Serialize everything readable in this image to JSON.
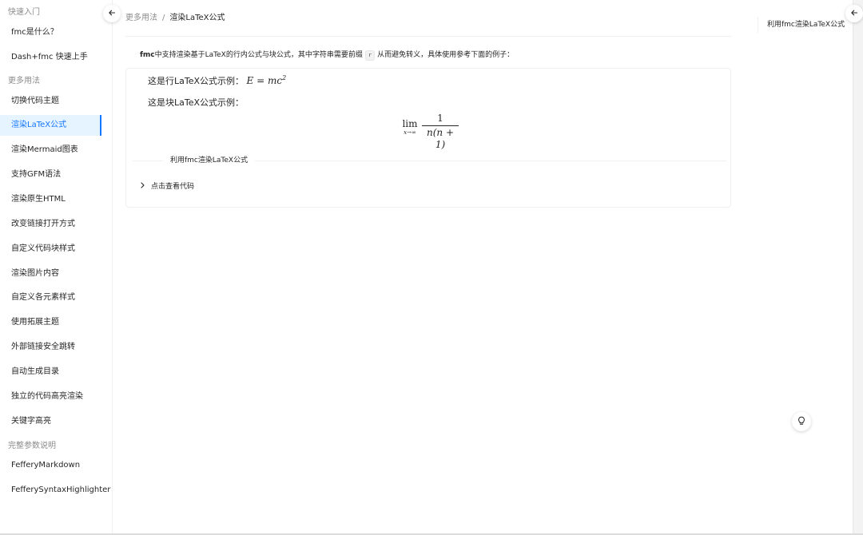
{
  "sidebar": {
    "groups": [
      {
        "title": "快速入门",
        "items": [
          "fmc是什么？",
          "Dash+fmc 快速上手"
        ]
      },
      {
        "title": "更多用法",
        "items": [
          "切换代码主题",
          "渲染LaTeX公式",
          "渲染Mermaid图表",
          "支持GFM语法",
          "渲染原生HTML",
          "改变链接打开方式",
          "自定义代码块样式",
          "渲染图片内容",
          "自定义各元素样式",
          "使用拓展主题",
          "外部链接安全跳转",
          "自动生成目录",
          "独立的代码高亮渲染",
          "关键字高亮"
        ]
      },
      {
        "title": "完整参数说明",
        "items": [
          "FefferyMarkdown",
          "FefferySyntaxHighlighter"
        ]
      }
    ],
    "active_item": "渲染LaTeX公式",
    "collapse_icon": "arrow-left-icon"
  },
  "breadcrumb": {
    "parent": "更多用法",
    "separator": "/",
    "current": "渲染LaTeX公式"
  },
  "intro": {
    "bold": "fmc",
    "text_before_code": "中支持渲染基于LaTeX的行内公式与块公式，其中字符串需要前缀",
    "code": "r",
    "text_after_code": "从而避免转义，具体使用参考下面的例子："
  },
  "demo": {
    "inline_label": "这是行LaTeX公式示例：",
    "inline_formula": {
      "lhs": "E",
      "eq": " = ",
      "rhs": "mc",
      "exp": "2"
    },
    "block_label": "这是块LaTeX公式示例：",
    "block_formula": {
      "op": "lim",
      "sub": "x→∞",
      "numerator": "1",
      "denominator": "n(n + 1)"
    },
    "divider_title": "利用fmc渲染LaTeX公式",
    "expand_label": "点击查看代码",
    "expand_icon": "chevron-right-icon"
  },
  "toc": {
    "items": [
      "利用fmc渲染LaTeX公式"
    ],
    "collapse_icon": "arrow-left-icon"
  },
  "float_button": {
    "icon": "lightbulb-icon"
  },
  "colors": {
    "accent": "#1677ff",
    "active_bg": "#e6f4ff"
  }
}
